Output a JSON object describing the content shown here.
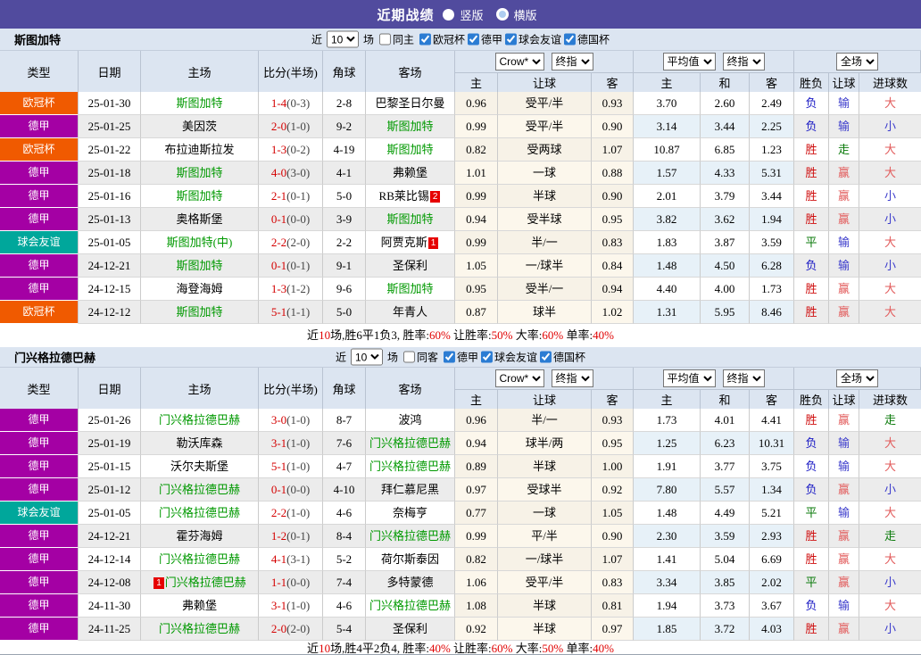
{
  "topbar": {
    "title": "近期战绩",
    "radio_vertical": "竖版",
    "radio_horizontal": "横版"
  },
  "filter_labels": {
    "near": "近",
    "count": "10",
    "matches": "场"
  },
  "table_header": {
    "type": "类型",
    "date": "日期",
    "home": "主场",
    "score": "比分(半场)",
    "corner": "角球",
    "away": "客场",
    "crow_select": "Crow*",
    "final_select": "终指",
    "avg_select": "平均值",
    "final_select2": "终指",
    "full_select": "全场",
    "sub_home": "主",
    "sub_handicap": "让球",
    "sub_away": "客",
    "sub_avg_home": "主",
    "sub_draw": "和",
    "sub_avg_away": "客",
    "result_wdl": "胜负",
    "result_handicap": "让球",
    "result_goals": "进球数"
  },
  "colors": {
    "topbar_bg": "#514b9e",
    "panel_bg": "#dce5f1",
    "highlight_team": "#009900",
    "score_red": "#d40000",
    "summary_red": "#e00000",
    "checkbox_blue": "#2b7cd3",
    "type_colors": {
      "欧冠杯": "#f05a00",
      "德甲": "#a400a4",
      "球会友谊": "#00a79b"
    },
    "result_colors": {
      "胜": "#cf0e0e",
      "赢": "#e25b5b",
      "走": "#0a7a0a",
      "平": "#0a7a0a",
      "负": "#1a1ac4",
      "输": "#3c3ccc",
      "大": "#e25b5b",
      "小": "#3c3ccc"
    }
  },
  "sections": [
    {
      "team": "斯图加特",
      "same_label": "同主",
      "same_checked": false,
      "comps": [
        {
          "label": "欧冠杯",
          "checked": true
        },
        {
          "label": "德甲",
          "checked": true
        },
        {
          "label": "球会友谊",
          "checked": true
        },
        {
          "label": "德国杯",
          "checked": true
        }
      ],
      "rows": [
        {
          "comp": "欧冠杯",
          "date": "25-01-30",
          "home": {
            "name": "斯图加特",
            "hl": true
          },
          "score": "1-4",
          "half": "(0-3)",
          "corner": "2-8",
          "away": {
            "name": "巴黎圣日尔曼",
            "hl": false
          },
          "crow": [
            "0.96",
            "受平/半",
            "0.93"
          ],
          "avg": [
            "3.70",
            "2.60",
            "2.49"
          ],
          "result": [
            "负",
            "输",
            "大"
          ]
        },
        {
          "comp": "德甲",
          "date": "25-01-25",
          "home": {
            "name": "美因茨",
            "hl": false
          },
          "score": "2-0",
          "half": "(1-0)",
          "corner": "9-2",
          "away": {
            "name": "斯图加特",
            "hl": true
          },
          "crow": [
            "0.99",
            "受平/半",
            "0.90"
          ],
          "avg": [
            "3.14",
            "3.44",
            "2.25"
          ],
          "result": [
            "负",
            "输",
            "小"
          ]
        },
        {
          "comp": "欧冠杯",
          "date": "25-01-22",
          "home": {
            "name": "布拉迪斯拉发",
            "hl": false
          },
          "score": "1-3",
          "half": "(0-2)",
          "corner": "4-19",
          "away": {
            "name": "斯图加特",
            "hl": true
          },
          "crow": [
            "0.82",
            "受两球",
            "1.07"
          ],
          "avg": [
            "10.87",
            "6.85",
            "1.23"
          ],
          "result": [
            "胜",
            "走",
            "大"
          ]
        },
        {
          "comp": "德甲",
          "date": "25-01-18",
          "home": {
            "name": "斯图加特",
            "hl": true
          },
          "score": "4-0",
          "half": "(3-0)",
          "corner": "4-1",
          "away": {
            "name": "弗赖堡",
            "hl": false
          },
          "crow": [
            "1.01",
            "一球",
            "0.88"
          ],
          "avg": [
            "1.57",
            "4.33",
            "5.31"
          ],
          "result": [
            "胜",
            "赢",
            "大"
          ]
        },
        {
          "comp": "德甲",
          "date": "25-01-16",
          "home": {
            "name": "斯图加特",
            "hl": true
          },
          "score": "2-1",
          "half": "(0-1)",
          "corner": "5-0",
          "away": {
            "name": "RB莱比锡",
            "hl": false,
            "badge": "2"
          },
          "crow": [
            "0.99",
            "半球",
            "0.90"
          ],
          "avg": [
            "2.01",
            "3.79",
            "3.44"
          ],
          "result": [
            "胜",
            "赢",
            "小"
          ]
        },
        {
          "comp": "德甲",
          "date": "25-01-13",
          "home": {
            "name": "奥格斯堡",
            "hl": false
          },
          "score": "0-1",
          "half": "(0-0)",
          "corner": "3-9",
          "away": {
            "name": "斯图加特",
            "hl": true
          },
          "crow": [
            "0.94",
            "受半球",
            "0.95"
          ],
          "avg": [
            "3.82",
            "3.62",
            "1.94"
          ],
          "result": [
            "胜",
            "赢",
            "小"
          ]
        },
        {
          "comp": "球会友谊",
          "date": "25-01-05",
          "home": {
            "name": "斯图加特(中)",
            "hl": true
          },
          "score": "2-2",
          "half": "(2-0)",
          "corner": "2-2",
          "away": {
            "name": "阿贾克斯",
            "hl": false,
            "badge": "1"
          },
          "crow": [
            "0.99",
            "半/一",
            "0.83"
          ],
          "avg": [
            "1.83",
            "3.87",
            "3.59"
          ],
          "result": [
            "平",
            "输",
            "大"
          ]
        },
        {
          "comp": "德甲",
          "date": "24-12-21",
          "home": {
            "name": "斯图加特",
            "hl": true
          },
          "score": "0-1",
          "half": "(0-1)",
          "corner": "9-1",
          "away": {
            "name": "圣保利",
            "hl": false
          },
          "crow": [
            "1.05",
            "一/球半",
            "0.84"
          ],
          "avg": [
            "1.48",
            "4.50",
            "6.28"
          ],
          "result": [
            "负",
            "输",
            "小"
          ]
        },
        {
          "comp": "德甲",
          "date": "24-12-15",
          "home": {
            "name": "海登海姆",
            "hl": false
          },
          "score": "1-3",
          "half": "(1-2)",
          "corner": "9-6",
          "away": {
            "name": "斯图加特",
            "hl": true
          },
          "crow": [
            "0.95",
            "受半/一",
            "0.94"
          ],
          "avg": [
            "4.40",
            "4.00",
            "1.73"
          ],
          "result": [
            "胜",
            "赢",
            "大"
          ]
        },
        {
          "comp": "欧冠杯",
          "date": "24-12-12",
          "home": {
            "name": "斯图加特",
            "hl": true
          },
          "score": "5-1",
          "half": "(1-1)",
          "corner": "5-0",
          "away": {
            "name": "年青人",
            "hl": false
          },
          "crow": [
            "0.87",
            "球半",
            "1.02"
          ],
          "avg": [
            "1.31",
            "5.95",
            "8.46"
          ],
          "result": [
            "胜",
            "赢",
            "大"
          ]
        }
      ],
      "summary": [
        {
          "text": "近",
          "red": false
        },
        {
          "text": "10",
          "red": true
        },
        {
          "text": "场,胜6平1负3, 胜率:",
          "red": false
        },
        {
          "text": "60%",
          "red": true
        },
        {
          "text": " 让胜率:",
          "red": false
        },
        {
          "text": "50%",
          "red": true
        },
        {
          "text": " 大率:",
          "red": false
        },
        {
          "text": "60%",
          "red": true
        },
        {
          "text": " 单率:",
          "red": false
        },
        {
          "text": "40%",
          "red": true
        }
      ]
    },
    {
      "team": "门兴格拉德巴赫",
      "same_label": "同客",
      "same_checked": false,
      "comps": [
        {
          "label": "德甲",
          "checked": true
        },
        {
          "label": "球会友谊",
          "checked": true
        },
        {
          "label": "德国杯",
          "checked": true
        }
      ],
      "rows": [
        {
          "comp": "德甲",
          "date": "25-01-26",
          "home": {
            "name": "门兴格拉德巴赫",
            "hl": true
          },
          "score": "3-0",
          "half": "(1-0)",
          "corner": "8-7",
          "away": {
            "name": "波鸿",
            "hl": false
          },
          "crow": [
            "0.96",
            "半/一",
            "0.93"
          ],
          "avg": [
            "1.73",
            "4.01",
            "4.41"
          ],
          "result": [
            "胜",
            "赢",
            "走"
          ]
        },
        {
          "comp": "德甲",
          "date": "25-01-19",
          "home": {
            "name": "勒沃库森",
            "hl": false
          },
          "score": "3-1",
          "half": "(1-0)",
          "corner": "7-6",
          "away": {
            "name": "门兴格拉德巴赫",
            "hl": true
          },
          "crow": [
            "0.94",
            "球半/两",
            "0.95"
          ],
          "avg": [
            "1.25",
            "6.23",
            "10.31"
          ],
          "result": [
            "负",
            "输",
            "大"
          ]
        },
        {
          "comp": "德甲",
          "date": "25-01-15",
          "home": {
            "name": "沃尔夫斯堡",
            "hl": false
          },
          "score": "5-1",
          "half": "(1-0)",
          "corner": "4-7",
          "away": {
            "name": "门兴格拉德巴赫",
            "hl": true
          },
          "crow": [
            "0.89",
            "半球",
            "1.00"
          ],
          "avg": [
            "1.91",
            "3.77",
            "3.75"
          ],
          "result": [
            "负",
            "输",
            "大"
          ]
        },
        {
          "comp": "德甲",
          "date": "25-01-12",
          "home": {
            "name": "门兴格拉德巴赫",
            "hl": true
          },
          "score": "0-1",
          "half": "(0-0)",
          "corner": "4-10",
          "away": {
            "name": "拜仁慕尼黑",
            "hl": false
          },
          "crow": [
            "0.97",
            "受球半",
            "0.92"
          ],
          "avg": [
            "7.80",
            "5.57",
            "1.34"
          ],
          "result": [
            "负",
            "赢",
            "小"
          ]
        },
        {
          "comp": "球会友谊",
          "date": "25-01-05",
          "home": {
            "name": "门兴格拉德巴赫",
            "hl": true
          },
          "score": "2-2",
          "half": "(1-0)",
          "corner": "4-6",
          "away": {
            "name": "奈梅亨",
            "hl": false
          },
          "crow": [
            "0.77",
            "一球",
            "1.05"
          ],
          "avg": [
            "1.48",
            "4.49",
            "5.21"
          ],
          "result": [
            "平",
            "输",
            "大"
          ]
        },
        {
          "comp": "德甲",
          "date": "24-12-21",
          "home": {
            "name": "霍芬海姆",
            "hl": false
          },
          "score": "1-2",
          "half": "(0-1)",
          "corner": "8-4",
          "away": {
            "name": "门兴格拉德巴赫",
            "hl": true
          },
          "crow": [
            "0.99",
            "平/半",
            "0.90"
          ],
          "avg": [
            "2.30",
            "3.59",
            "2.93"
          ],
          "result": [
            "胜",
            "赢",
            "走"
          ]
        },
        {
          "comp": "德甲",
          "date": "24-12-14",
          "home": {
            "name": "门兴格拉德巴赫",
            "hl": true
          },
          "score": "4-1",
          "half": "(3-1)",
          "corner": "5-2",
          "away": {
            "name": "荷尔斯泰因",
            "hl": false
          },
          "crow": [
            "0.82",
            "一/球半",
            "1.07"
          ],
          "avg": [
            "1.41",
            "5.04",
            "6.69"
          ],
          "result": [
            "胜",
            "赢",
            "大"
          ]
        },
        {
          "comp": "德甲",
          "date": "24-12-08",
          "home": {
            "name": "门兴格拉德巴赫",
            "hl": true,
            "badge_before": "1"
          },
          "score": "1-1",
          "half": "(0-0)",
          "corner": "7-4",
          "away": {
            "name": "多特蒙德",
            "hl": false
          },
          "crow": [
            "1.06",
            "受平/半",
            "0.83"
          ],
          "avg": [
            "3.34",
            "3.85",
            "2.02"
          ],
          "result": [
            "平",
            "赢",
            "小"
          ]
        },
        {
          "comp": "德甲",
          "date": "24-11-30",
          "home": {
            "name": "弗赖堡",
            "hl": false
          },
          "score": "3-1",
          "half": "(1-0)",
          "corner": "4-6",
          "away": {
            "name": "门兴格拉德巴赫",
            "hl": true
          },
          "crow": [
            "1.08",
            "半球",
            "0.81"
          ],
          "avg": [
            "1.94",
            "3.73",
            "3.67"
          ],
          "result": [
            "负",
            "输",
            "大"
          ]
        },
        {
          "comp": "德甲",
          "date": "24-11-25",
          "home": {
            "name": "门兴格拉德巴赫",
            "hl": true
          },
          "score": "2-0",
          "half": "(2-0)",
          "corner": "5-4",
          "away": {
            "name": "圣保利",
            "hl": false
          },
          "crow": [
            "0.92",
            "半球",
            "0.97"
          ],
          "avg": [
            "1.85",
            "3.72",
            "4.03"
          ],
          "result": [
            "胜",
            "赢",
            "小"
          ]
        }
      ],
      "summary": [
        {
          "text": "近",
          "red": false
        },
        {
          "text": "10",
          "red": true
        },
        {
          "text": "场,胜4平2负4, 胜率:",
          "red": false
        },
        {
          "text": "40%",
          "red": true
        },
        {
          "text": " 让胜率:",
          "red": false
        },
        {
          "text": "60%",
          "red": true
        },
        {
          "text": " 大率:",
          "red": false
        },
        {
          "text": "50%",
          "red": true
        },
        {
          "text": " 单率:",
          "red": false
        },
        {
          "text": "40%",
          "red": true
        }
      ]
    }
  ]
}
